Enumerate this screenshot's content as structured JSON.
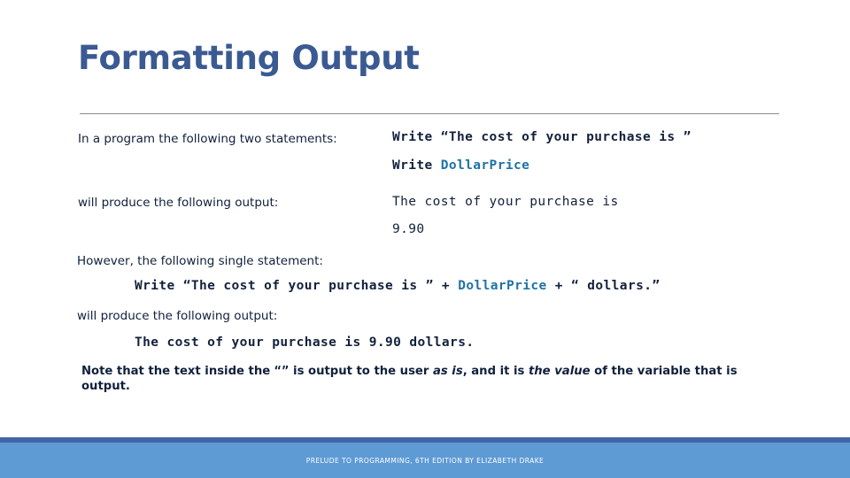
{
  "slide": {
    "title": "Formatting Output",
    "rows": [
      {
        "label": "In a program the following two statements:",
        "code_line_1_a": "Write ",
        "code_line_1_b": "“The cost of your purchase is ”",
        "code_line_2_a": "Write ",
        "code_line_2_var": "DollarPrice"
      },
      {
        "label": "will produce the following output:",
        "output_line_1": "The cost of your purchase is",
        "output_line_2": "9.90"
      }
    ],
    "however_label": "However, the following single statement:",
    "single_statement": {
      "a": "Write “The cost of your purchase is ” + ",
      "var": "DollarPrice",
      "b": " + “ dollars.”"
    },
    "will_produce_label": "will produce the following output:",
    "final_output": "The cost of your purchase is 9.90 dollars.",
    "note": {
      "part1": "Note that the text inside the ",
      "quote_open": "“",
      "quote_close": "”",
      "part2": " is output to the user ",
      "italic1": "as is",
      "part3": ", and it is ",
      "italic2": "the value",
      "part4": " of the variable that is output."
    },
    "footer": "PRELUDE TO PROGRAMMING, 6TH EDITION BY ELIZABETH DRAKE",
    "colors": {
      "title": "#3b5a92",
      "body_text": "#10203c",
      "variable": "#1f72a8",
      "footer_stripe": "#4266a8",
      "footer_band": "#5e9bd5",
      "rule": "#8a8a8a"
    }
  }
}
